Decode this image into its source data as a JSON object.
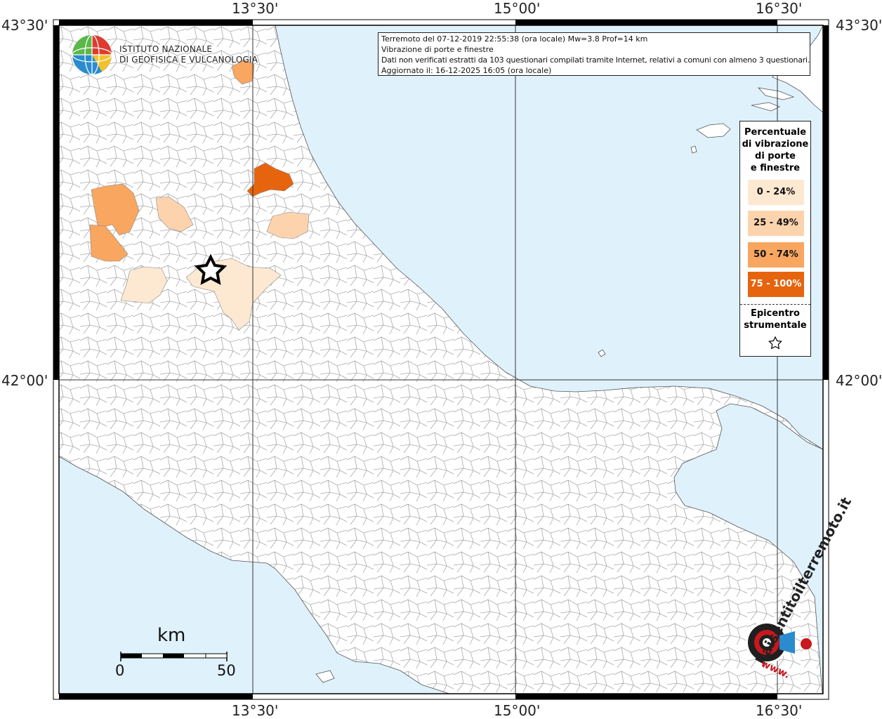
{
  "axes": {
    "lon_labels": [
      "13°30'",
      "15°00'",
      "16°30'"
    ],
    "lat_labels": [
      "43°30'",
      "42°00'"
    ]
  },
  "info": {
    "line1": "Terremoto del 07-12-2019 22:55:38 (ora locale) Mw=3.8 Prof=14 km",
    "line2": "Vibrazione di porte e finestre",
    "line3": "Dati non verificati estratti da 103 questionari compilati tramite Internet, relativi a comuni con almeno 3 questionari.",
    "line4": "Aggiornato il: 16-12-2025 16:05 (ora locale)"
  },
  "logo": {
    "line1": "ISTITUTO NAZIONALE",
    "line2": "DI GEOFISICA E VULCANOLOGIA"
  },
  "legend": {
    "title_lines": [
      "Percentuale",
      "di vibrazione",
      "di porte",
      "e finestre"
    ],
    "items": [
      {
        "label": "0 - 24%",
        "color": "#fde8d2"
      },
      {
        "label": "25 - 49%",
        "color": "#fdd3ae"
      },
      {
        "label": "50 - 74%",
        "color": "#f8a660"
      },
      {
        "label": "75 - 100%",
        "color": "#e6640e"
      }
    ],
    "epicenter_lines": [
      "Epicentro",
      "strumentale"
    ]
  },
  "scale": {
    "unit": "km",
    "start": "0",
    "end": "50"
  },
  "watermark": {
    "text": "haisentitoilterremoto.it",
    "www": "www."
  },
  "colors": {
    "sea": "#dff1fb",
    "land": "#ffffff",
    "borders": "#9a9a9a"
  }
}
